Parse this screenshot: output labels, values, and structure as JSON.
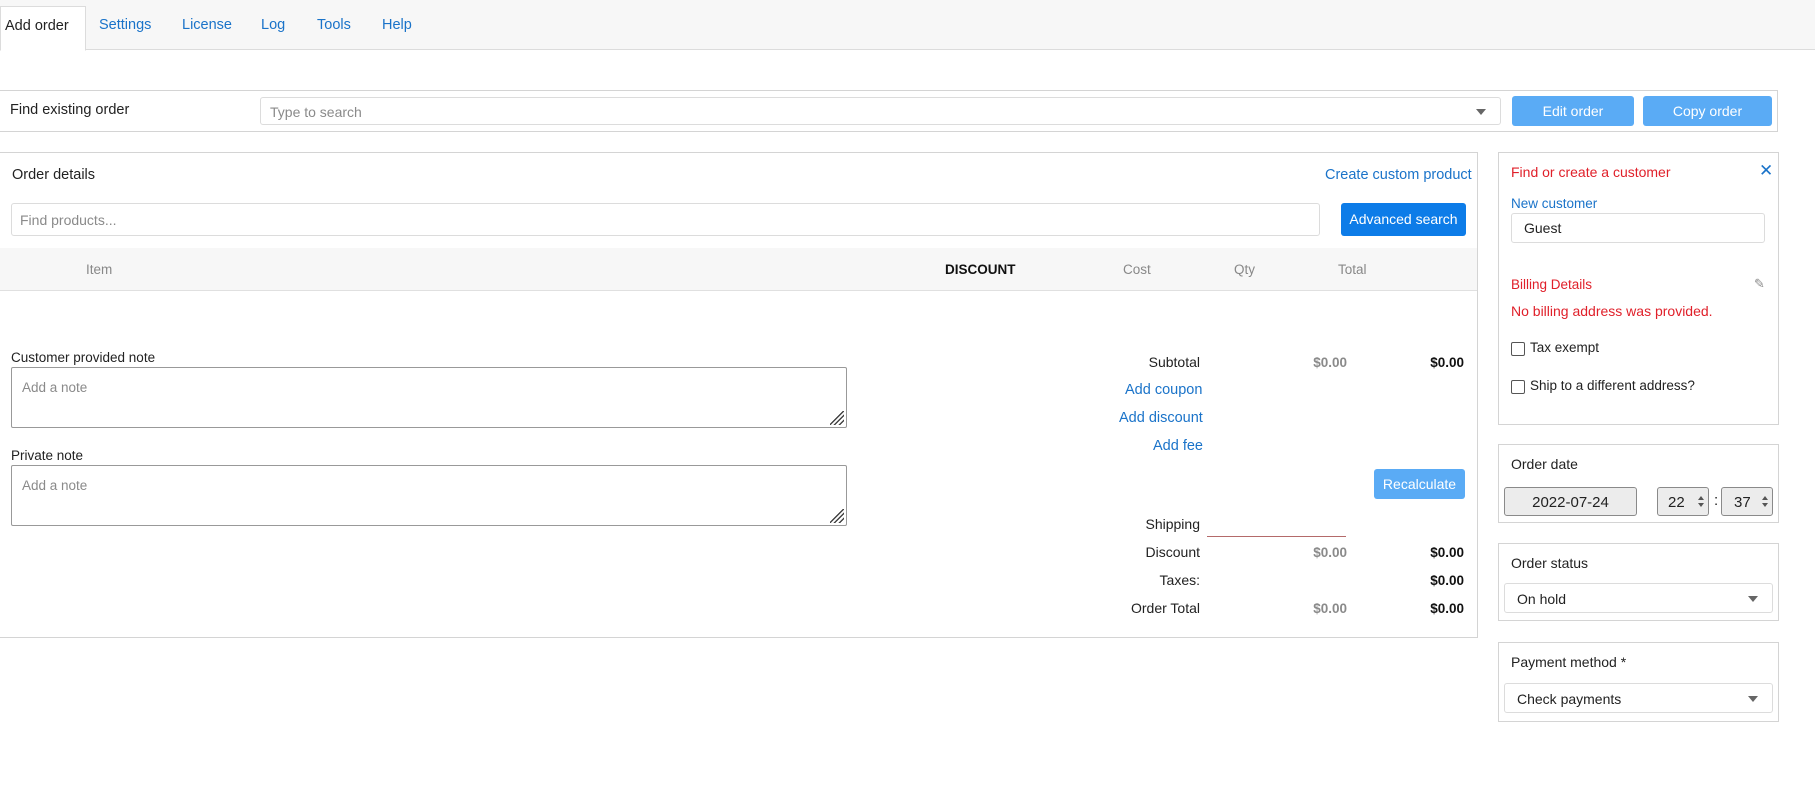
{
  "tabs": [
    {
      "label": "Add order",
      "active": true
    },
    {
      "label": "Settings"
    },
    {
      "label": "License"
    },
    {
      "label": "Log"
    },
    {
      "label": "Tools"
    },
    {
      "label": "Help"
    }
  ],
  "find_order": {
    "label": "Find existing order",
    "placeholder": "Type to search",
    "edit_button": "Edit order",
    "copy_button": "Copy order"
  },
  "order_details": {
    "title": "Order details",
    "create_custom_product": "Create custom product",
    "product_search_placeholder": "Find products...",
    "advanced_search": "Advanced search",
    "columns": {
      "item": "Item",
      "discount": "DISCOUNT",
      "cost": "Cost",
      "qty": "Qty",
      "total": "Total"
    },
    "customer_note_label": "Customer provided note",
    "customer_note_placeholder": "Add a note",
    "private_note_label": "Private note",
    "private_note_placeholder": "Add a note",
    "totals": {
      "subtotal_label": "Subtotal",
      "subtotal_grey": "$0.00",
      "subtotal_value": "$0.00",
      "add_coupon": "Add coupon",
      "add_discount": "Add discount",
      "add_fee": "Add fee",
      "recalculate": "Recalculate",
      "shipping_label": "Shipping",
      "discount_label": "Discount",
      "discount_grey": "$0.00",
      "discount_value": "$0.00",
      "taxes_label": "Taxes:",
      "taxes_value": "$0.00",
      "order_total_label": "Order Total",
      "order_total_grey": "$0.00",
      "order_total_value": "$0.00"
    }
  },
  "customer": {
    "title": "Find or create a customer",
    "new_customer_label": "New customer",
    "customer_value": "Guest",
    "billing_title": "Billing Details",
    "no_billing": "No billing address was provided.",
    "tax_exempt": "Tax exempt",
    "ship_different": "Ship to a different address?"
  },
  "order_date": {
    "title": "Order date",
    "date": "2022-07-24",
    "hour": "22",
    "separator": ":",
    "minute": "37"
  },
  "order_status": {
    "title": "Order status",
    "value": "On hold"
  },
  "payment_method": {
    "title": "Payment method *",
    "value": "Check payments"
  },
  "colors": {
    "link": "#1a73c9",
    "primary_button": "#0d7ce8",
    "light_button": "#5aabf5",
    "alert_red": "#e0202a"
  }
}
